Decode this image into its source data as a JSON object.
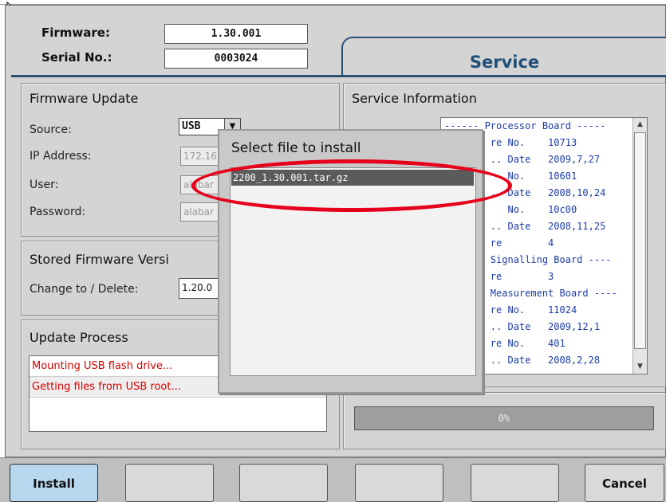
{
  "header": {
    "firmware_label": "Firmware:",
    "firmware_value": "1.30.001",
    "serial_label": "Serial No.:",
    "serial_value": "0003024",
    "service_title": "Service"
  },
  "firmware_update": {
    "title": "Firmware Update",
    "source_label": "Source:",
    "source_value": "USB",
    "ip_label": "IP Address:",
    "ip_value": "172.16",
    "user_label": "User:",
    "user_value": "alabar",
    "password_label": "Password:",
    "password_value": "alabar"
  },
  "stored_firmware": {
    "title": "Stored Firmware Versi",
    "change_label": "Change to / Delete:",
    "change_value": "1.20.0"
  },
  "update_process": {
    "title": "Update Process",
    "log": [
      "Mounting USB flash drive...",
      "Getting files from USB root..."
    ]
  },
  "service_information": {
    "title": "Service Information",
    "lines": [
      "------ Processor Board -----",
      "        re No.    10713",
      "        .. Date   2009,7,27",
      "           No.    10601",
      "        .. Date   2008,10,24",
      "           No.    10c00",
      "        .. Date   2008,11,25",
      "        re        4",
      "        Signalling Board ----",
      "        re        3",
      "        Measurement Board ----",
      "        re No.    11024",
      "        .. Date   2009,12,1",
      "        re No.    401",
      "        .. Date   2008,2,28"
    ]
  },
  "progress": {
    "label": "0%",
    "value": 0
  },
  "dialog": {
    "title": "Select file to install",
    "files": [
      "2200_1.30.001.tar.gz"
    ]
  },
  "buttons": {
    "install": "Install",
    "cancel": "Cancel"
  },
  "colors": {
    "accent": "#1f4e79",
    "log_text": "#d60000",
    "service_text": "#1a3aa8",
    "annotation": "#e6001b"
  }
}
